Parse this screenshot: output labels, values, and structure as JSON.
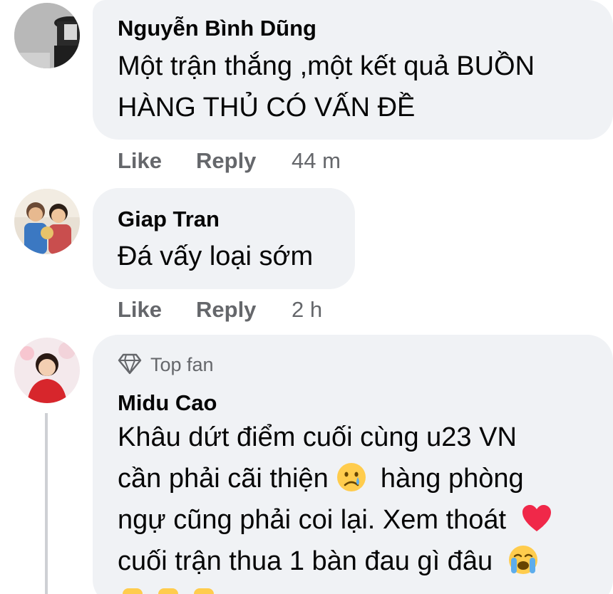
{
  "comments": [
    {
      "author": "Nguyễn Bình Dũng",
      "lines": [
        "Một trận thắng ,một kết quả BUỒN",
        "HÀNG THỦ CÓ VẤN ĐỀ"
      ],
      "actions": {
        "like": "Like",
        "reply": "Reply",
        "time": "44 m"
      }
    },
    {
      "author": "Giap Tran",
      "lines": [
        "Đá vấy loại sớm"
      ],
      "actions": {
        "like": "Like",
        "reply": "Reply",
        "time": "2 h"
      }
    },
    {
      "badge": "Top fan",
      "author": "Midu Cao",
      "lines": [
        "Khâu dứt điểm cuối cùng u23 VN",
        "cần phải cãi thiện",
        "hàng phòng",
        "ngự cũng phải coi lại. Xem thoát",
        "cuối trận thua 1 bàn đau gì đâu"
      ]
    }
  ],
  "icons": {
    "sad_emoji": "sad-tear-emoji",
    "heart_emoji": "red-heart-emoji",
    "crying_emoji": "loudly-crying-emoji",
    "badge_icon": "diamond-icon"
  },
  "colors": {
    "bubble": "#f0f2f5",
    "secondary_text": "#65676b",
    "heart": "#f02849",
    "emoji_yellow": "#ffcc4d"
  }
}
